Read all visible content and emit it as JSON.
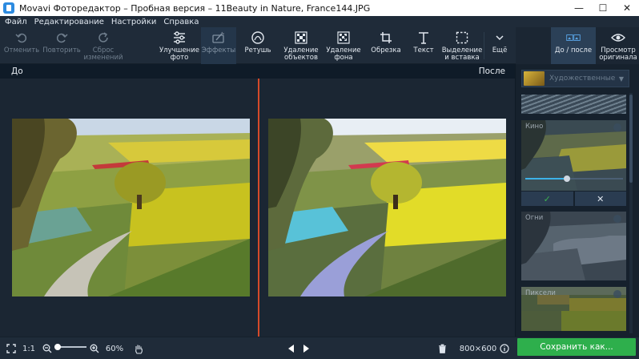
{
  "window": {
    "title": "Movavi Фоторедактор – Пробная версия – 11Beauty in Nature, France144.JPG",
    "minimize": "—",
    "maximize": "☐",
    "close": "✕"
  },
  "menu": [
    "Файл",
    "Редактирование",
    "Настройки",
    "Справка"
  ],
  "toolbar": {
    "undo": "Отменить",
    "redo": "Повторить",
    "reset": "Сброс\nизменений",
    "enhance": "Улучшение\nфото",
    "effects": "Эффекты",
    "retouch": "Ретушь",
    "object_removal": "Удаление\nобъектов",
    "bg_removal": "Удаление\nфона",
    "crop": "Обрезка",
    "text": "Текст",
    "select_insert": "Выделение\nи вставка",
    "more": "Ещё",
    "before_after": "До / после",
    "view_original": "Просмотр\nоригинала"
  },
  "compare": {
    "before": "До",
    "after": "После"
  },
  "effects_panel": {
    "category": "Художественные",
    "selected_effect": "Кино",
    "effects": [
      "Кино",
      "Огни",
      "Пиксели"
    ],
    "apply": "✓",
    "cancel": "✕",
    "intensity": 0.43
  },
  "statusbar": {
    "fit": "1:1",
    "zoom": "60%",
    "zoom_level": 0.1,
    "dimensions": "800×600",
    "save": "Сохранить как..."
  },
  "colors": {
    "accent_green": "#2eaf4c",
    "divider_red": "#d54a2a",
    "slider_blue": "#3db2e8"
  }
}
